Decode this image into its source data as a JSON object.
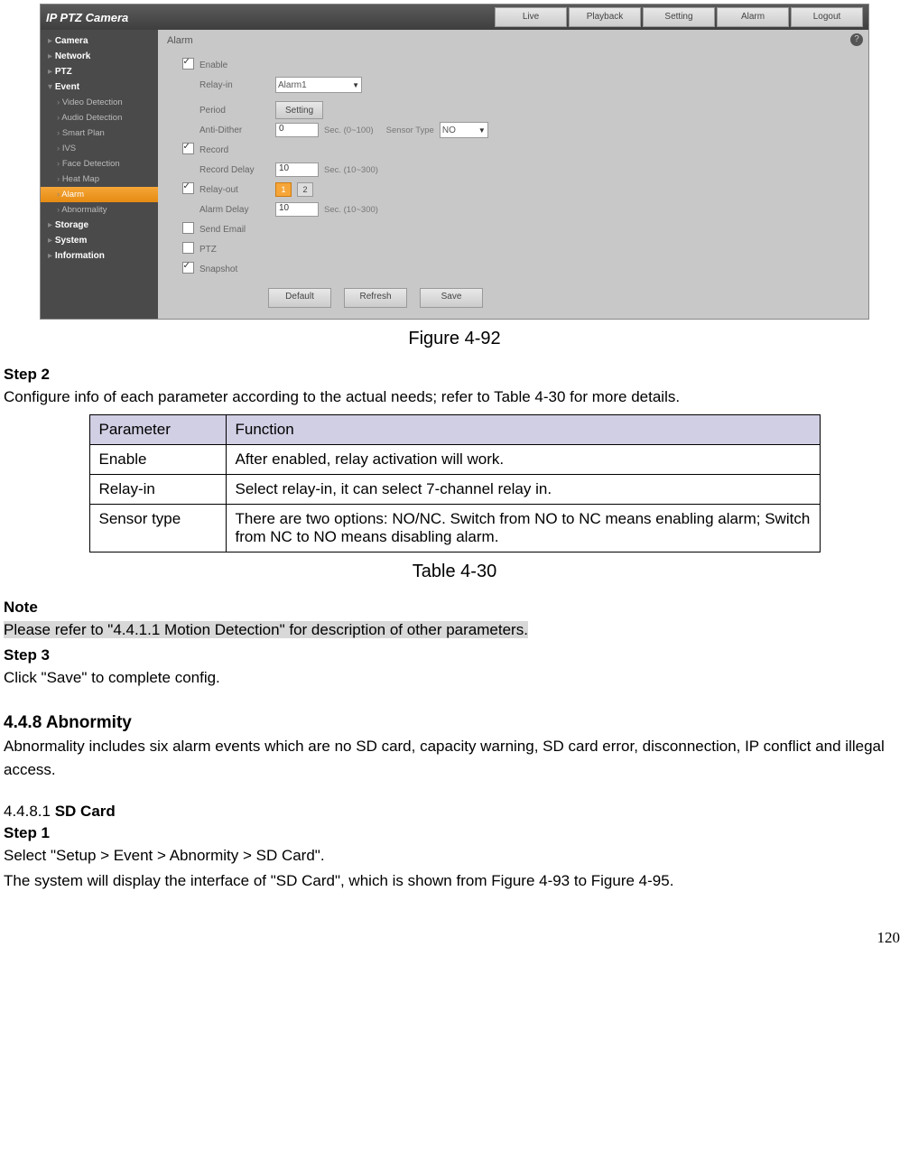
{
  "app": {
    "title": "IP PTZ Camera",
    "tabs": [
      "Live",
      "Playback",
      "Setting",
      "Alarm",
      "Logout"
    ],
    "help_icon": "?"
  },
  "sidebar": {
    "groups": {
      "camera": "Camera",
      "network": "Network",
      "ptz": "PTZ",
      "event": "Event",
      "storage": "Storage",
      "system": "System",
      "information": "Information"
    },
    "event_children": {
      "video_detection": "Video Detection",
      "audio_detection": "Audio Detection",
      "smart_plan": "Smart Plan",
      "ivs": "IVS",
      "face_detection": "Face Detection",
      "heat_map": "Heat Map",
      "alarm": "Alarm",
      "abnormality": "Abnormality"
    }
  },
  "panel": {
    "title": "Alarm",
    "enable_label": "Enable",
    "relay_in_label": "Relay-in",
    "relay_in_value": "Alarm1",
    "period_label": "Period",
    "period_button": "Setting",
    "anti_dither_label": "Anti-Dither",
    "anti_dither_value": "0",
    "anti_dither_hint": "Sec. (0~100)",
    "sensor_type_label": "Sensor Type",
    "sensor_type_value": "NO",
    "record_label": "Record",
    "record_delay_label": "Record Delay",
    "record_delay_value": "10",
    "record_delay_hint": "Sec. (10~300)",
    "relay_out_label": "Relay-out",
    "relay_out_chips": [
      "1",
      "2"
    ],
    "alarm_delay_label": "Alarm Delay",
    "alarm_delay_value": "10",
    "alarm_delay_hint": "Sec. (10~300)",
    "send_email_label": "Send Email",
    "ptz_label": "PTZ",
    "snapshot_label": "Snapshot",
    "buttons": {
      "default": "Default",
      "refresh": "Refresh",
      "save": "Save"
    }
  },
  "doc": {
    "figure_caption": "Figure 4-92",
    "step2_title": "Step 2",
    "step2_text": "Configure info of each parameter according to the actual needs; refer to Table 4-30 for more details.",
    "table_header": {
      "param": "Parameter",
      "func": "Function"
    },
    "table_rows": [
      {
        "p": "Enable",
        "f": "After enabled, relay activation will work."
      },
      {
        "p": "Relay-in",
        "f": "Select relay-in, it can select 7-channel relay in."
      },
      {
        "p": "Sensor type",
        "f": "There are two options: NO/NC. Switch from NO to NC means enabling alarm; Switch from NC to NO means disabling alarm."
      }
    ],
    "table_caption": "Table 4-30",
    "note_title": "Note",
    "note_text": "Please refer to \"4.4.1.1 Motion Detection\" for description of other parameters.",
    "step3_title": "Step 3",
    "step3_text": "Click \"Save\" to complete config.",
    "section_448": "4.4.8   Abnormity",
    "section_448_text": "Abnormality includes six alarm events which are no SD card, capacity warning, SD card error, disconnection, IP conflict and illegal access.",
    "sub_4481_num": "4.4.8.1 ",
    "sub_4481_title": "SD Card",
    "sub_step1_title": "Step 1",
    "sub_step1_text1": "Select \"Setup > Event > Abnormity > SD Card\".",
    "sub_step1_text2": "The system will display the interface of \"SD Card\", which is shown from Figure 4-93 to Figure 4-95.",
    "page_number": "120"
  }
}
